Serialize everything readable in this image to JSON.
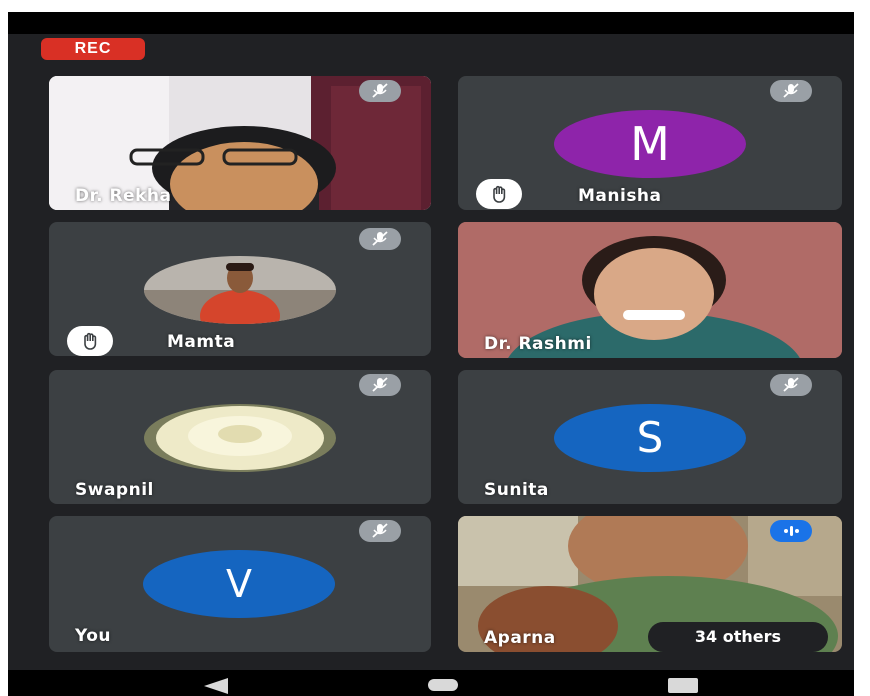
{
  "recording": {
    "label": "REC"
  },
  "participants": [
    {
      "name": "Dr. Rekha"
    },
    {
      "name": "Manisha",
      "avatar_letter": "M",
      "avatar_color": "#8e24aa",
      "hand_raised": true
    },
    {
      "name": "Mamta",
      "hand_raised": true
    },
    {
      "name": "Dr. Rashmi"
    },
    {
      "name": "Swapnil"
    },
    {
      "name": "Sunita",
      "avatar_letter": "S",
      "avatar_color": "#1565c0"
    },
    {
      "name": "You",
      "avatar_letter": "V",
      "avatar_color": "#1565c0"
    },
    {
      "name": "Aparna"
    }
  ],
  "others": {
    "label": "34 others"
  },
  "colors": {
    "tile": "#3c4043",
    "background": "#202124",
    "rec": "#d93025",
    "speaking": "#1a73e8"
  },
  "icons": {
    "mute": "mic-off-icon",
    "hand": "raised-hand-icon",
    "speaking": "audio-level-icon"
  }
}
